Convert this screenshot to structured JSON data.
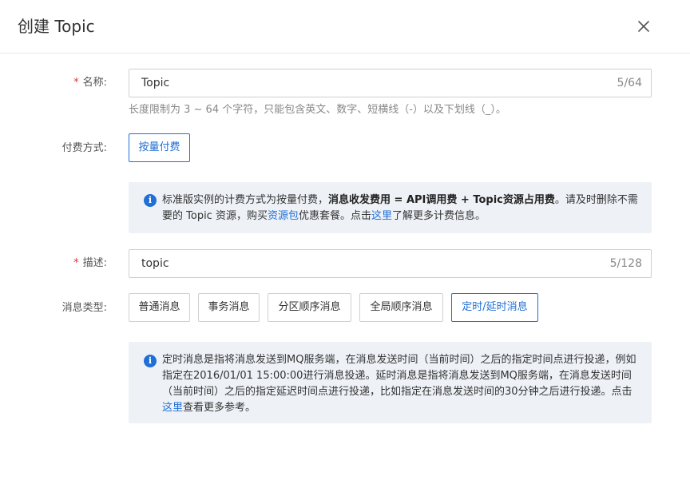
{
  "dialog": {
    "title": "创建 Topic"
  },
  "form": {
    "name": {
      "label": "名称:",
      "required": "*",
      "value": "Topic",
      "counter": "5/64",
      "hint": "长度限制为 3 ~ 64 个字符，只能包含英文、数字、短横线（-）以及下划线（_）。"
    },
    "billing": {
      "label": "付费方式:",
      "option": "按量付费",
      "info": {
        "part1": "标准版实例的计费方式为按量付费，",
        "bold": "消息收发费用 = API调用费 + Topic资源占用费",
        "part2": "。请及时删除不需要的 Topic 资源，购买",
        "link1": "资源包",
        "part3": "优惠套餐。点击",
        "link2": "这里",
        "part4": "了解更多计费信息。"
      }
    },
    "description": {
      "label": "描述:",
      "required": "*",
      "value": "topic",
      "counter": "5/128"
    },
    "message_type": {
      "label": "消息类型:",
      "options": [
        "普通消息",
        "事务消息",
        "分区顺序消息",
        "全局顺序消息",
        "定时/延时消息"
      ],
      "selected": "定时/延时消息",
      "info": {
        "part1": "定时消息是指将消息发送到MQ服务端，在消息发送时间（当前时间）之后的指定时间点进行投递，例如指定在2016/01/01 15:00:00进行消息投递。延时消息是指将消息发送到MQ服务端，在消息发送时间（当前时间）之后的指定延迟时间点进行投递，比如指定在消息发送时间的30分钟之后进行投递。点击",
        "link": "这里",
        "part2": "查看更多参考。"
      }
    }
  },
  "colors": {
    "accent": "#1f6fd6",
    "required": "#e0303a",
    "info_bg": "#eef1f6"
  },
  "icons": {
    "close": "close-icon",
    "info": "info-icon"
  }
}
